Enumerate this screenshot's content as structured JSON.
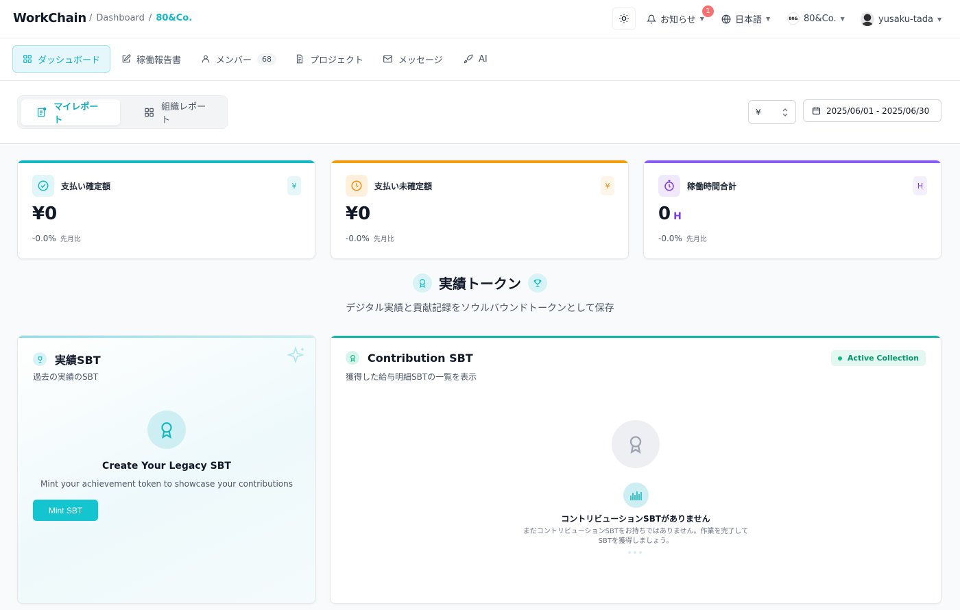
{
  "header": {
    "logo": "WorkChain",
    "breadcrumb": {
      "sep1": "/",
      "root": "Dashboard",
      "sep2": "/",
      "current": "80&Co."
    },
    "notifications": {
      "label": "お知らせ",
      "badge": "1"
    },
    "language": "日本語",
    "org": {
      "logo_text": "80&",
      "name": "80&Co."
    },
    "user": "yusaku-tada"
  },
  "nav": {
    "items": [
      {
        "label": "ダッシュボード",
        "icon": "grid-icon"
      },
      {
        "label": "稼働報告書",
        "icon": "edit-icon"
      },
      {
        "label": "メンバー",
        "icon": "user-icon",
        "count": "68"
      },
      {
        "label": "プロジェクト",
        "icon": "document-icon"
      },
      {
        "label": "メッセージ",
        "icon": "mail-icon"
      },
      {
        "label": "AI",
        "icon": "rocket-icon"
      }
    ]
  },
  "toolbar": {
    "tabs": [
      "マイレポート",
      "組織レポート"
    ],
    "currency": "¥",
    "date_range": "2025/06/01 - 2025/06/30"
  },
  "stats": [
    {
      "title": "支払い確定額",
      "unit": "¥",
      "value": "¥0",
      "change": "-0.0%",
      "change_label": "先月比",
      "color": "#14b8c4"
    },
    {
      "title": "支払い未確定額",
      "unit": "¥",
      "value": "¥0",
      "change": "-0.0%",
      "change_label": "先月比",
      "color": "#f59e0b"
    },
    {
      "title": "稼働時間合計",
      "unit": "H",
      "value": "0",
      "value_unit": "H",
      "change": "-0.0%",
      "change_label": "先月比",
      "color": "#8b5cf6"
    }
  ],
  "tokens": {
    "title": "実績トークン",
    "subtitle": "デジタル実績と貢献記録をソウルバウンドトークンとして保存",
    "legacy": {
      "title": "実績SBT",
      "subtitle": "過去の実績のSBT",
      "cta_title": "Create Your Legacy SBT",
      "cta_subtitle": "Mint your achievement token to showcase your contributions",
      "button": "Mint SBT"
    },
    "contribution": {
      "title": "Contribution SBT",
      "subtitle": "獲得した給与明細SBTの一覧を表示",
      "status": "Active Collection",
      "empty_title": "コントリビューションSBTがありません",
      "empty_subtitle": "まだコントリビューションSBTをお持ちではありません。作業を完了してSBTを獲得しましょう。"
    }
  }
}
